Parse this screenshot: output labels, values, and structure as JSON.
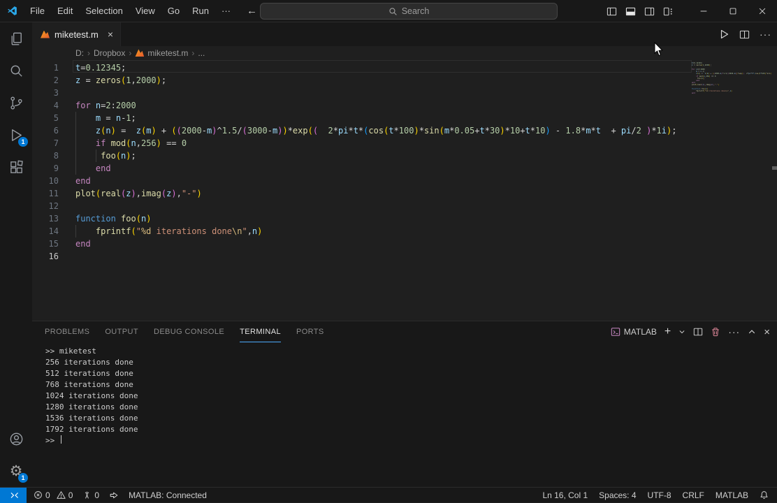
{
  "titlebar": {
    "menus": [
      "File",
      "Edit",
      "Selection",
      "View",
      "Go",
      "Run",
      "···"
    ],
    "search_placeholder": "Search"
  },
  "tab": {
    "label": "miketest.m"
  },
  "editor_actions": {
    "run": "run",
    "split": "split-editor",
    "more": "···"
  },
  "breadcrumb": {
    "items": [
      "D:",
      "Dropbox",
      "miketest.m",
      "..."
    ]
  },
  "activitybar": {
    "debug_badge": "1",
    "settings_badge": "1"
  },
  "editor": {
    "current_line": 16,
    "lines": [
      {
        "segs": [
          [
            "var",
            "t"
          ],
          [
            "op",
            "="
          ],
          [
            "num",
            "0.12345"
          ],
          [
            "op",
            ";"
          ]
        ]
      },
      {
        "segs": [
          [
            "var",
            "z"
          ],
          [
            "op",
            " = "
          ],
          [
            "fn",
            "zeros"
          ],
          [
            "b1",
            "("
          ],
          [
            "num",
            "1"
          ],
          [
            "op",
            ","
          ],
          [
            "num",
            "2000"
          ],
          [
            "b1",
            ")"
          ],
          [
            "op",
            ";"
          ]
        ]
      },
      {
        "segs": []
      },
      {
        "segs": [
          [
            "kw",
            "for"
          ],
          [
            "op",
            " "
          ],
          [
            "var",
            "n"
          ],
          [
            "op",
            "="
          ],
          [
            "num",
            "2"
          ],
          [
            "op",
            ":"
          ],
          [
            "num",
            "2000"
          ]
        ]
      },
      {
        "segs": [
          [
            "op",
            "    "
          ],
          [
            "var",
            "m"
          ],
          [
            "op",
            " = "
          ],
          [
            "var",
            "n"
          ],
          [
            "op",
            "-"
          ],
          [
            "num",
            "1"
          ],
          [
            "op",
            ";"
          ]
        ]
      },
      {
        "segs": [
          [
            "op",
            "    "
          ],
          [
            "var",
            "z"
          ],
          [
            "b1",
            "("
          ],
          [
            "var",
            "n"
          ],
          [
            "b1",
            ")"
          ],
          [
            "op",
            " =  "
          ],
          [
            "var",
            "z"
          ],
          [
            "b1",
            "("
          ],
          [
            "var",
            "m"
          ],
          [
            "b1",
            ")"
          ],
          [
            "op",
            " + "
          ],
          [
            "b1",
            "("
          ],
          [
            "b2",
            "("
          ],
          [
            "num",
            "2000"
          ],
          [
            "op",
            "-"
          ],
          [
            "var",
            "m"
          ],
          [
            "b2",
            ")"
          ],
          [
            "op",
            "^"
          ],
          [
            "num",
            "1.5"
          ],
          [
            "op",
            "/"
          ],
          [
            "b2",
            "("
          ],
          [
            "num",
            "3000"
          ],
          [
            "op",
            "-"
          ],
          [
            "var",
            "m"
          ],
          [
            "b2",
            ")"
          ],
          [
            "b1",
            ")"
          ],
          [
            "op",
            "*"
          ],
          [
            "fn",
            "exp"
          ],
          [
            "b1",
            "("
          ],
          [
            "b2",
            "("
          ],
          [
            "op",
            "  "
          ],
          [
            "num",
            "2"
          ],
          [
            "op",
            "*"
          ],
          [
            "var",
            "pi"
          ],
          [
            "op",
            "*"
          ],
          [
            "var",
            "t"
          ],
          [
            "op",
            "*"
          ],
          [
            "b3",
            "("
          ],
          [
            "fn",
            "cos"
          ],
          [
            "b1",
            "("
          ],
          [
            "var",
            "t"
          ],
          [
            "op",
            "*"
          ],
          [
            "num",
            "100"
          ],
          [
            "b1",
            ")"
          ],
          [
            "op",
            "*"
          ],
          [
            "fn",
            "sin"
          ],
          [
            "b1",
            "("
          ],
          [
            "var",
            "m"
          ],
          [
            "op",
            "*"
          ],
          [
            "num",
            "0.05"
          ],
          [
            "op",
            "+"
          ],
          [
            "var",
            "t"
          ],
          [
            "op",
            "*"
          ],
          [
            "num",
            "30"
          ],
          [
            "b1",
            ")"
          ],
          [
            "op",
            "*"
          ],
          [
            "num",
            "10"
          ],
          [
            "op",
            "+"
          ],
          [
            "var",
            "t"
          ],
          [
            "op",
            "*"
          ],
          [
            "num",
            "10"
          ],
          [
            "b3",
            ")"
          ],
          [
            "op",
            " - "
          ],
          [
            "num",
            "1.8"
          ],
          [
            "op",
            "*"
          ],
          [
            "var",
            "m"
          ],
          [
            "op",
            "*"
          ],
          [
            "var",
            "t"
          ],
          [
            "op",
            "  + "
          ],
          [
            "var",
            "pi"
          ],
          [
            "op",
            "/"
          ],
          [
            "num",
            "2"
          ],
          [
            "op",
            " "
          ],
          [
            "b2",
            ")"
          ],
          [
            "op",
            "*"
          ],
          [
            "num",
            "1"
          ],
          [
            "var",
            "i"
          ],
          [
            "b1",
            ")"
          ],
          [
            "op",
            ";"
          ]
        ]
      },
      {
        "segs": [
          [
            "op",
            "    "
          ],
          [
            "kw",
            "if"
          ],
          [
            "op",
            " "
          ],
          [
            "fn",
            "mod"
          ],
          [
            "b1",
            "("
          ],
          [
            "var",
            "n"
          ],
          [
            "op",
            ","
          ],
          [
            "num",
            "256"
          ],
          [
            "b1",
            ")"
          ],
          [
            "op",
            " == "
          ],
          [
            "num",
            "0"
          ]
        ]
      },
      {
        "segs": [
          [
            "op",
            "     "
          ],
          [
            "fn",
            "foo"
          ],
          [
            "b1",
            "("
          ],
          [
            "var",
            "n"
          ],
          [
            "b1",
            ")"
          ],
          [
            "op",
            ";"
          ]
        ]
      },
      {
        "segs": [
          [
            "op",
            "    "
          ],
          [
            "kw",
            "end"
          ]
        ]
      },
      {
        "segs": [
          [
            "kw",
            "end"
          ]
        ]
      },
      {
        "segs": [
          [
            "fn",
            "plot"
          ],
          [
            "b1",
            "("
          ],
          [
            "fn",
            "real"
          ],
          [
            "b2",
            "("
          ],
          [
            "var",
            "z"
          ],
          [
            "b2",
            ")"
          ],
          [
            "op",
            ","
          ],
          [
            "fn",
            "imag"
          ],
          [
            "b2",
            "("
          ],
          [
            "var",
            "z"
          ],
          [
            "b2",
            ")"
          ],
          [
            "op",
            ","
          ],
          [
            "str",
            "\"-\""
          ],
          [
            "b1",
            ")"
          ]
        ]
      },
      {
        "segs": []
      },
      {
        "segs": [
          [
            "kw2",
            "function"
          ],
          [
            "op",
            " "
          ],
          [
            "fn",
            "foo"
          ],
          [
            "b1",
            "("
          ],
          [
            "var",
            "n"
          ],
          [
            "b1",
            ")"
          ]
        ]
      },
      {
        "segs": [
          [
            "op",
            "    "
          ],
          [
            "fn",
            "fprintf"
          ],
          [
            "b1",
            "("
          ],
          [
            "str",
            "\""
          ],
          [
            "esc",
            "%d"
          ],
          [
            "str",
            " iterations done"
          ],
          [
            "esc",
            "\\n"
          ],
          [
            "str",
            "\""
          ],
          [
            "op",
            ","
          ],
          [
            "var",
            "n"
          ],
          [
            "b1",
            ")"
          ]
        ]
      },
      {
        "segs": [
          [
            "kw",
            "end"
          ]
        ]
      },
      {
        "segs": []
      }
    ]
  },
  "panel": {
    "tabs": [
      {
        "label": "PROBLEMS",
        "active": false
      },
      {
        "label": "OUTPUT",
        "active": false
      },
      {
        "label": "DEBUG CONSOLE",
        "active": false
      },
      {
        "label": "TERMINAL",
        "active": true
      },
      {
        "label": "PORTS",
        "active": false
      }
    ],
    "terminal_name": "MATLAB",
    "terminal_lines": [
      ">> miketest",
      "256 iterations done",
      "512 iterations done",
      "768 iterations done",
      "1024 iterations done",
      "1280 iterations done",
      "1536 iterations done",
      "1792 iterations done",
      ">> "
    ]
  },
  "statusbar": {
    "errors": "0",
    "warnings": "0",
    "ports": "0",
    "matlab_status": "MATLAB: Connected",
    "line_col": "Ln 16, Col 1",
    "indent": "Spaces: 4",
    "encoding": "UTF-8",
    "eol": "CRLF",
    "language": "MATLAB"
  },
  "colors": {
    "accent": "#0078d4",
    "badge": "#0078d4",
    "matlab_icon_orange": "#e4572e",
    "terminal_tab_underline": "#4daafc",
    "tokens": {
      "kw": "#C586C0",
      "kw2": "#569CD6",
      "var": "#9CDCFE",
      "num": "#B5CEA8",
      "fn": "#DCDCAA",
      "str": "#CE9178",
      "esc": "#D7BA7D",
      "op": "#D4D4D4",
      "b1": "#FFD700",
      "b2": "#DA70D6",
      "b3": "#179FFF",
      "txt": "#CCCCCC"
    }
  }
}
